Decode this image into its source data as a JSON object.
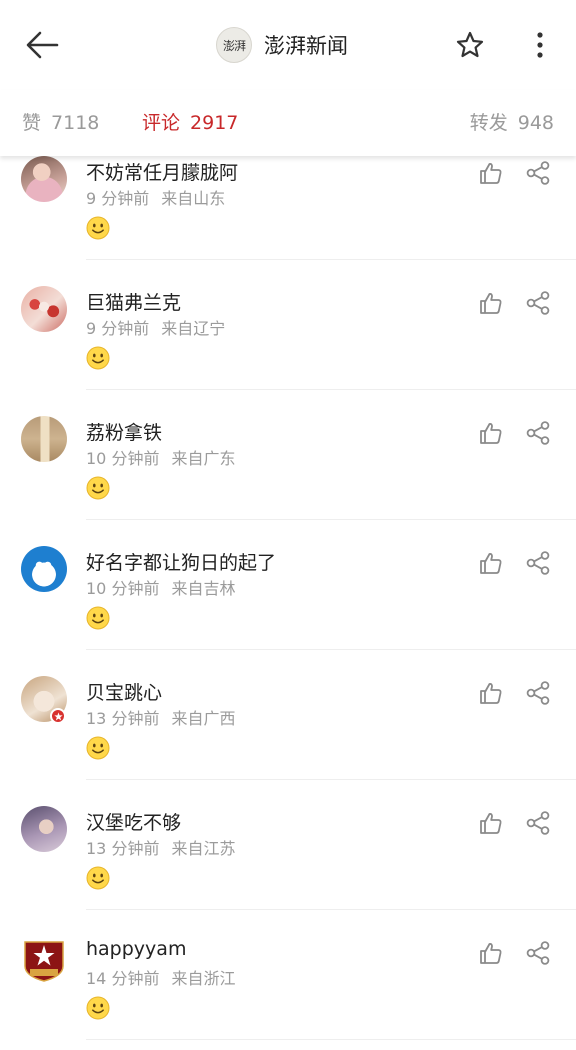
{
  "header": {
    "brand_name": "澎湃新闻",
    "brand_logo_text": "澎湃"
  },
  "stats": {
    "likes_label": "赞",
    "likes_count": "7118",
    "comments_label": "评论",
    "comments_count": "2917",
    "reposts_label": "转发",
    "reposts_count": "948",
    "active_color": "#c8282a"
  },
  "comments": [
    {
      "name": "不妨常任月朦胧阿",
      "time": "9 分钟前",
      "location": "来自山东",
      "avatar": "avatar-girl-pink"
    },
    {
      "name": "巨猫弗兰克",
      "time": "9 分钟前",
      "location": "来自辽宁",
      "avatar": "avatar-red-decoration"
    },
    {
      "name": "荔粉拿铁",
      "time": "10 分钟前",
      "location": "来自广东",
      "avatar": "avatar-bottle-tan"
    },
    {
      "name": "好名字都让狗日的起了",
      "time": "10 分钟前",
      "location": "来自吉林",
      "avatar": "avatar-doraemon"
    },
    {
      "name": "贝宝跳心",
      "time": "13 分钟前",
      "location": "来自广西",
      "avatar": "avatar-cat-verified"
    },
    {
      "name": "汉堡吃不够",
      "time": "13 分钟前",
      "location": "来自江苏",
      "avatar": "avatar-purple-person"
    },
    {
      "name": "happyyam",
      "time": "14 分钟前",
      "location": "来自浙江",
      "avatar": "avatar-red-shield"
    }
  ]
}
